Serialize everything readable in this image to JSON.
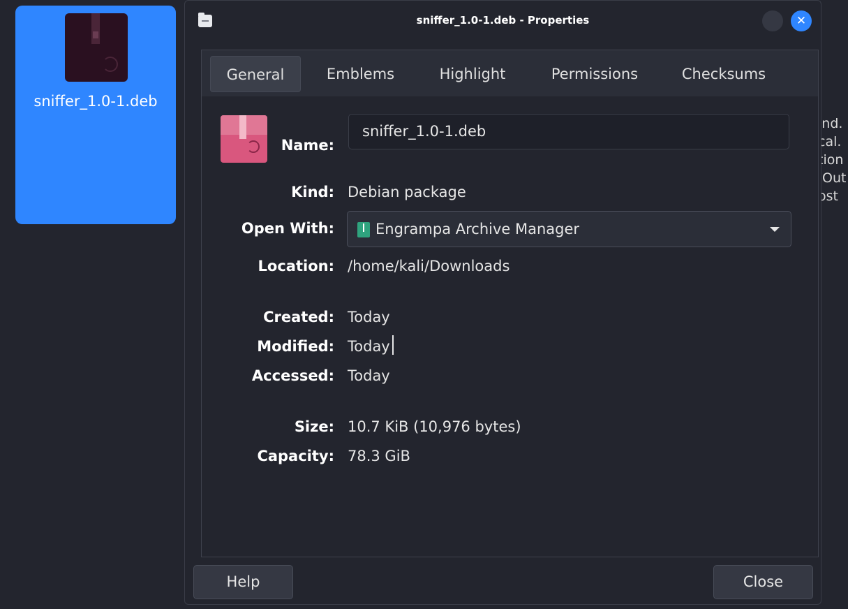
{
  "desktop": {
    "file_label": "sniffer_1.0-1.deb",
    "background_text_lines": [
      "ınd.",
      "cal.",
      "tion",
      ".Out",
      "ost"
    ]
  },
  "window": {
    "title": "sniffer_1.0-1.deb - Properties",
    "close_glyph": "✕"
  },
  "tabs": [
    "General",
    "Emblems",
    "Highlight",
    "Permissions",
    "Checksums"
  ],
  "general": {
    "name_label": "Name:",
    "name_value": "sniffer_1.0-1.deb",
    "kind_label": "Kind:",
    "kind_value": "Debian package",
    "open_with_label": "Open With:",
    "open_with_value": "Engrampa Archive Manager",
    "location_label": "Location:",
    "location_value": "/home/kali/Downloads",
    "created_label": "Created:",
    "created_value": "Today",
    "modified_label": "Modified:",
    "modified_value": "Today",
    "accessed_label": "Accessed:",
    "accessed_value": "Today",
    "size_label": "Size:",
    "size_value": "10.7 KiB (10,976 bytes)",
    "capacity_label": "Capacity:",
    "capacity_value": "78.3 GiB"
  },
  "buttons": {
    "help": "Help",
    "close": "Close"
  },
  "colors": {
    "accent": "#2f86ff",
    "background": "#23252e",
    "file_icon": "#d9577e"
  }
}
